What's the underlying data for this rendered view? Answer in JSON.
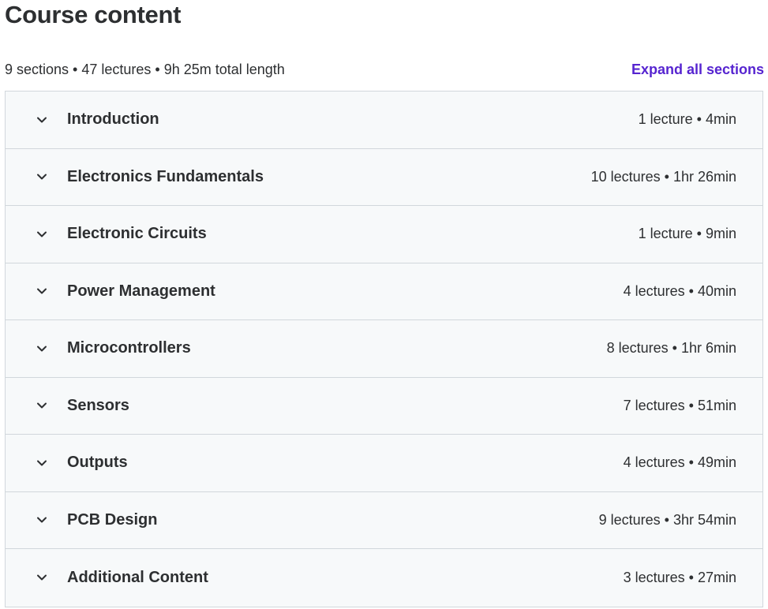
{
  "heading": "Course content",
  "summary": {
    "text": "9 sections • 47 lectures • 9h 25m total length",
    "expand_label": "Expand all sections"
  },
  "colors": {
    "accent": "#5624d0",
    "section_bg": "#f7f9fa",
    "border": "#d1d7dc",
    "text": "#2d2f31"
  },
  "sections": [
    {
      "title": "Introduction",
      "meta": "1 lecture • 4min",
      "icon": "chevron-down-icon"
    },
    {
      "title": "Electronics Fundamentals",
      "meta": "10 lectures • 1hr 26min",
      "icon": "chevron-down-icon"
    },
    {
      "title": "Electronic Circuits",
      "meta": "1 lecture • 9min",
      "icon": "chevron-down-icon"
    },
    {
      "title": "Power Management",
      "meta": "4 lectures • 40min",
      "icon": "chevron-down-icon"
    },
    {
      "title": "Microcontrollers",
      "meta": "8 lectures • 1hr 6min",
      "icon": "chevron-down-icon"
    },
    {
      "title": "Sensors",
      "meta": "7 lectures • 51min",
      "icon": "chevron-down-icon"
    },
    {
      "title": "Outputs",
      "meta": "4 lectures • 49min",
      "icon": "chevron-down-icon"
    },
    {
      "title": "PCB Design",
      "meta": "9 lectures • 3hr 54min",
      "icon": "chevron-down-icon"
    },
    {
      "title": "Additional Content",
      "meta": "3 lectures • 27min",
      "icon": "chevron-down-icon"
    }
  ]
}
